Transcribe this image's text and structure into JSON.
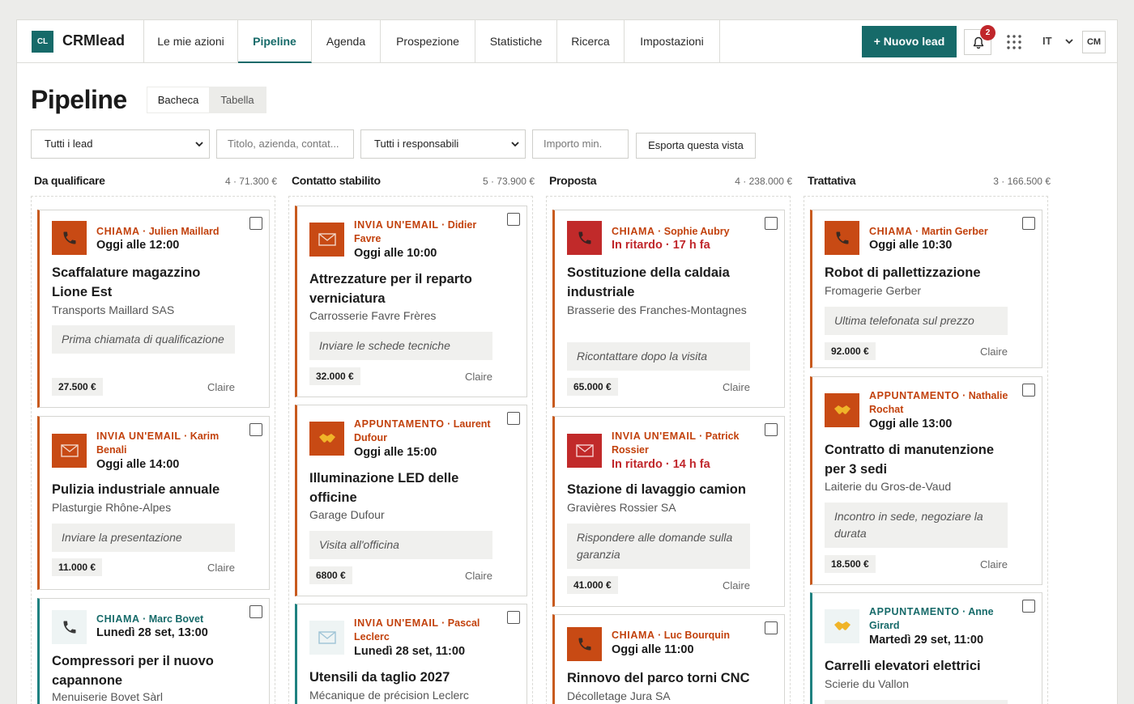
{
  "brand": {
    "logo": "CL",
    "name": "CRMlead"
  },
  "nav": [
    {
      "label": "Le mie azioni",
      "active": false
    },
    {
      "label": "Pipeline",
      "active": true
    },
    {
      "label": "Agenda",
      "active": false
    },
    {
      "label": "Prospezione",
      "active": false
    },
    {
      "label": "Statistiche",
      "active": false
    },
    {
      "label": "Ricerca",
      "active": false
    },
    {
      "label": "Impostazioni",
      "active": false
    }
  ],
  "topbar": {
    "new_lead": "+ Nuovo lead",
    "notifications": "2",
    "lang": "IT",
    "user": "CM"
  },
  "page": {
    "title": "Pipeline",
    "view_board": "Bacheca",
    "view_table": "Tabella"
  },
  "filters": {
    "lead_filter": "Tutti i lead",
    "search_placeholder": "Titolo, azienda, contat...",
    "owner_filter": "Tutti i responsabili",
    "amount_placeholder": "Importo min.",
    "export": "Esporta questa vista"
  },
  "colors": {
    "accent": "#166a69",
    "orange": "#c2410c",
    "danger": "#c0262b"
  },
  "columns": [
    {
      "title": "Da qualificare",
      "meta": "4 · 71.300 €",
      "cards": [
        {
          "kind": "CHIAMA",
          "contact": "· Julien Maillard",
          "when": "Oggi alle 12:00",
          "title": "Scaffalature magazzino Lione Est",
          "company": "Transports Maillard SAS",
          "note": "Prima chiamata di qualificazione",
          "amount": "27.500 €",
          "owner": "Claire",
          "icon": "phone-icon"
        },
        {
          "kind": "INVIA UN'EMAIL",
          "contact": "· Karim Benali",
          "when": "Oggi alle 14:00",
          "title": "Pulizia industriale annuale",
          "company": "Plasturgie Rhône-Alpes",
          "note": "Inviare la presentazione",
          "amount": "11.000 €",
          "owner": "Claire",
          "icon": "mail-icon"
        },
        {
          "kind": "CHIAMA",
          "contact": "· Marc Bovet",
          "when": "Lunedì 28 set, 13:00",
          "title": "Compressori per il nuovo capannone",
          "company": "Menuiserie Bovet Sàrl",
          "icon": "phone-icon"
        }
      ]
    },
    {
      "title": "Contatto stabilito",
      "meta": "5 · 73.900 €",
      "cards": [
        {
          "kind": "INVIA UN'EMAIL",
          "contact": "· Didier Favre",
          "when": "Oggi alle 10:00",
          "title": "Attrezzature per il reparto verniciatura",
          "company": "Carrosserie Favre Frères",
          "note": "Inviare le schede tecniche",
          "amount": "32.000 €",
          "owner": "Claire",
          "icon": "mail-icon"
        },
        {
          "kind": "APPUNTAMENTO",
          "contact": "· Laurent Dufour",
          "when": "Oggi alle 15:00",
          "title": "Illuminazione LED delle officine",
          "company": "Garage Dufour",
          "note": "Visita all'officina",
          "amount": "6800 €",
          "owner": "Claire",
          "icon": "handshake-icon"
        },
        {
          "kind": "INVIA UN'EMAIL",
          "contact": "· Pascal Leclerc",
          "when": "Lunedì 28 set, 11:00",
          "title": "Utensili da taglio 2027",
          "company": "Mécanique de précision Leclerc",
          "icon": "mail-icon"
        }
      ]
    },
    {
      "title": "Proposta",
      "meta": "4 · 238.000 €",
      "cards": [
        {
          "kind": "CHIAMA",
          "contact": "· Sophie Aubry",
          "when": "In ritardo · 17 h fa",
          "title": "Sostituzione della caldaia industriale",
          "company": "Brasserie des Franches-Montagnes",
          "note": "Ricontattare dopo la visita",
          "amount": "65.000 €",
          "owner": "Claire",
          "icon": "phone-icon"
        },
        {
          "kind": "INVIA UN'EMAIL",
          "contact": "· Patrick Rossier",
          "when": "In ritardo · 14 h fa",
          "title": "Stazione di lavaggio camion",
          "company": "Gravières Rossier SA",
          "note": "Rispondere alle domande sulla garanzia",
          "amount": "41.000 €",
          "owner": "Claire",
          "icon": "mail-icon"
        },
        {
          "kind": "CHIAMA",
          "contact": "· Luc Bourquin",
          "when": "Oggi alle 11:00",
          "title": "Rinnovo del parco torni CNC",
          "company": "Décolletage Jura SA",
          "icon": "phone-icon"
        }
      ]
    },
    {
      "title": "Trattativa",
      "meta": "3 · 166.500 €",
      "cards": [
        {
          "kind": "CHIAMA",
          "contact": "· Martin Gerber",
          "when": "Oggi alle 10:30",
          "title": "Robot di pallettizzazione",
          "company": "Fromagerie Gerber",
          "note": "Ultima telefonata sul prezzo",
          "amount": "92.000 €",
          "owner": "Claire",
          "icon": "phone-icon"
        },
        {
          "kind": "APPUNTAMENTO",
          "contact": "· Nathalie Rochat",
          "when": "Oggi alle 13:00",
          "title": "Contratto di manutenzione per 3 sedi",
          "company": "Laiterie du Gros-de-Vaud",
          "note": "Incontro in sede, negoziare la durata",
          "amount": "18.500 €",
          "owner": "Claire",
          "icon": "handshake-icon"
        },
        {
          "kind": "APPUNTAMENTO",
          "contact": "· Anne Girard",
          "when": "Martedì 29 set, 11:00",
          "title": "Carrelli elevatori elettrici",
          "company": "Scierie du Vallon",
          "icon": "handshake-icon"
        }
      ]
    }
  ]
}
